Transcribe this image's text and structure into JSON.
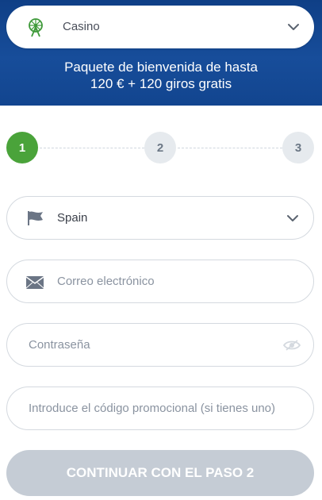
{
  "bonus_select": {
    "selected": "Casino",
    "icon": "ferris-wheel-icon"
  },
  "promo": {
    "line1": "Paquete de bienvenida de hasta",
    "line2": "120 € + 120 giros gratis"
  },
  "steps": [
    {
      "label": "1",
      "state": "active"
    },
    {
      "label": "2",
      "state": "inactive"
    },
    {
      "label": "3",
      "state": "inactive"
    }
  ],
  "form": {
    "country": {
      "value": "Spain",
      "icon": "flag-icon"
    },
    "email": {
      "placeholder": "Correo electrónico",
      "icon": "envelope-icon"
    },
    "password": {
      "placeholder": "Contraseña",
      "icon": "eye-icon"
    },
    "promo_code": {
      "placeholder": "Introduce el código promocional (si tienes uno)"
    }
  },
  "cta": {
    "label": "CONTINUAR CON EL PASO 2"
  },
  "colors": {
    "header_blue": "#174d9a",
    "step_active": "#4aa33a",
    "step_inactive": "#e6eaee",
    "cta_disabled": "#c5ccd5"
  }
}
